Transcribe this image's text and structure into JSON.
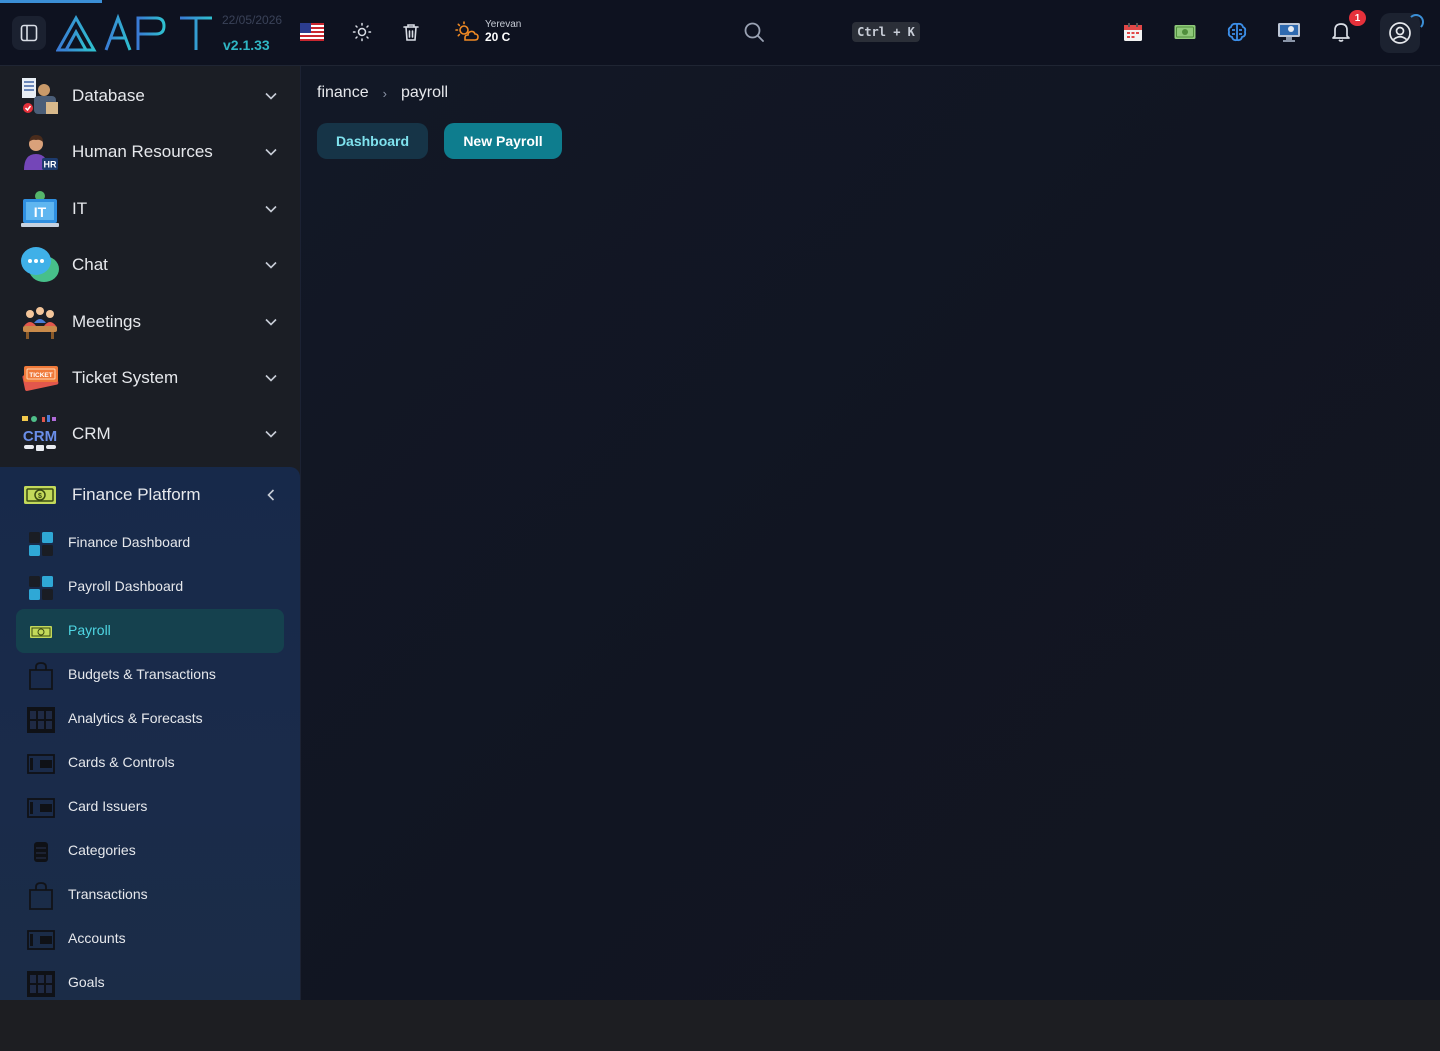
{
  "header": {
    "app_logo": "APIT",
    "date": "22/05/2026",
    "version": "v2.1.33",
    "weather": {
      "city": "Yerevan",
      "temp": "20 C"
    },
    "search_shortcut": "Ctrl + K",
    "notification_count": "1",
    "icons": [
      "sidebar-toggle-icon",
      "us-flag-icon",
      "sun-icon",
      "trash-icon",
      "weather-icon",
      "search-icon",
      "calendar-icon",
      "money-icon",
      "brain-icon",
      "monitor-icon",
      "bell-icon",
      "user-icon"
    ]
  },
  "sidebar": {
    "items": [
      {
        "label": "Database",
        "icon": "database-icon"
      },
      {
        "label": "Human Resources",
        "icon": "hr-icon"
      },
      {
        "label": "IT",
        "icon": "it-icon"
      },
      {
        "label": "Chat",
        "icon": "chat-icon"
      },
      {
        "label": "Meetings",
        "icon": "meetings-icon"
      },
      {
        "label": "Ticket System",
        "icon": "ticket-icon"
      },
      {
        "label": "CRM",
        "icon": "crm-icon"
      }
    ],
    "finance": {
      "label": "Finance Platform",
      "icon": "banknote-icon",
      "items": [
        {
          "label": "Finance Dashboard",
          "icon": "dashboard-icon"
        },
        {
          "label": "Payroll Dashboard",
          "icon": "dashboard-icon"
        },
        {
          "label": "Payroll",
          "icon": "banknote-icon",
          "active": true
        },
        {
          "label": "Budgets & Transactions",
          "icon": "bag-icon"
        },
        {
          "label": "Analytics & Forecasts",
          "icon": "table-icon"
        },
        {
          "label": "Cards & Controls",
          "icon": "card-icon"
        },
        {
          "label": "Card Issuers",
          "icon": "card-icon"
        },
        {
          "label": "Categories",
          "icon": "stack-icon"
        },
        {
          "label": "Transactions",
          "icon": "bag-icon"
        },
        {
          "label": "Accounts",
          "icon": "card-icon"
        },
        {
          "label": "Goals",
          "icon": "table-icon"
        }
      ]
    }
  },
  "main": {
    "breadcrumb": [
      "finance",
      "payroll"
    ],
    "buttons": {
      "dashboard": "Dashboard",
      "new_payroll": "New Payroll"
    }
  },
  "colors": {
    "accent": "#0e7d8e",
    "accent_text": "#4fd6e3",
    "badge": "#e5313b",
    "topbar": "#0e1220",
    "sidebar": "#1b1e25"
  }
}
